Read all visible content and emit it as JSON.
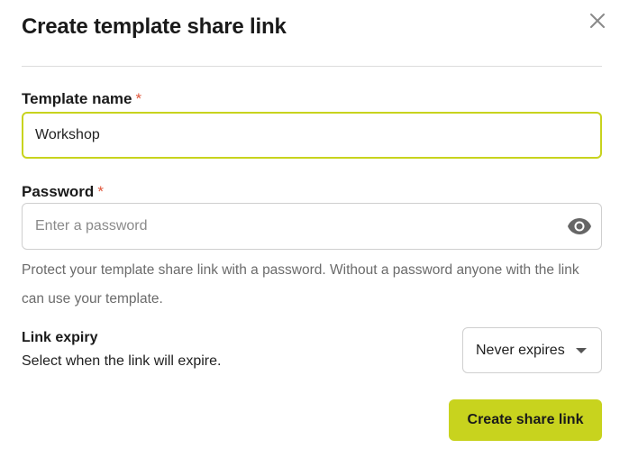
{
  "dialog": {
    "title": "Create template share link",
    "close_icon": "close-icon"
  },
  "template_name": {
    "label": "Template name",
    "required_mark": "*",
    "value": "Workshop"
  },
  "password": {
    "label": "Password",
    "required_mark": "*",
    "placeholder": "Enter a password",
    "value": "",
    "toggle_icon": "eye-icon",
    "help_text": "Protect your template share link with a password. Without a password anyone with the link can use your template."
  },
  "expiry": {
    "title": "Link expiry",
    "subtitle": "Select when the link will expire.",
    "selected": "Never expires",
    "caret_icon": "caret-down-icon"
  },
  "actions": {
    "create_label": "Create share link"
  },
  "colors": {
    "accent": "#c8d31e",
    "required": "#e0553a",
    "muted_text": "#6b6b6b",
    "border": "#cfcfcf"
  }
}
